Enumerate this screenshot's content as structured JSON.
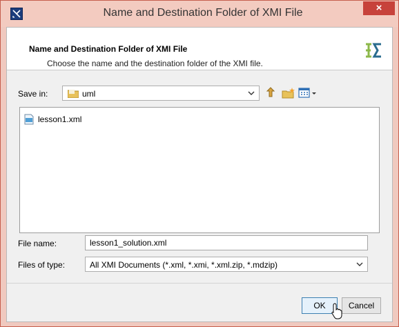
{
  "window": {
    "title": "Name and Destination Folder of XMI File",
    "close_label": "×"
  },
  "header": {
    "title": "Name and Destination Folder of XMI File",
    "subtitle": "Choose the name and the destination folder of the XMI file."
  },
  "save_in": {
    "label": "Save in:",
    "value": "uml"
  },
  "toolbar": {
    "icons": [
      "up-folder-icon",
      "new-folder-icon",
      "view-menu-icon"
    ]
  },
  "files": [
    {
      "name": "lesson1.xml",
      "icon": "xml-file-icon"
    }
  ],
  "file_name": {
    "label": "File name:",
    "value": "lesson1_solution.xml"
  },
  "file_type": {
    "label": "Files of type:",
    "value": "All XMI Documents (*.xml, *.xmi, *.xml.zip, *.mdzip)"
  },
  "buttons": {
    "ok": "OK",
    "cancel": "Cancel"
  },
  "colors": {
    "titlebar": "#f3cbc0",
    "close": "#c7423b",
    "accent": "#3c7fb1"
  }
}
